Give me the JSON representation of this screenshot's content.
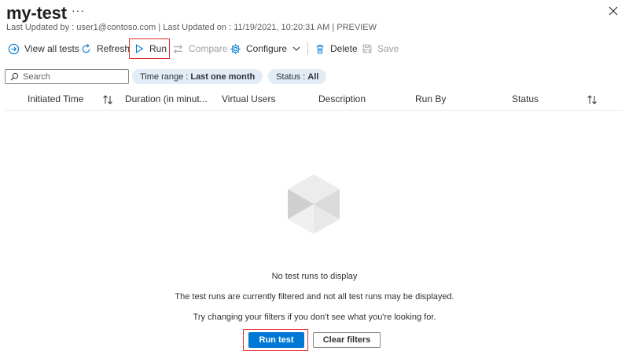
{
  "header": {
    "title": "my-test",
    "more_label": "···",
    "subtitle": "Last Updated by : user1@contoso.com | Last Updated on : 11/19/2021, 10:20:31 AM | PREVIEW"
  },
  "toolbar": {
    "view_all_tests": "View all tests",
    "refresh": "Refresh",
    "run": "Run",
    "compare": "Compare",
    "configure": "Configure",
    "delete": "Delete",
    "save": "Save"
  },
  "filters": {
    "search_placeholder": "Search",
    "time_range_label": "Time range :",
    "time_range_value": "Last one month",
    "status_label": "Status :",
    "status_value": "All"
  },
  "table": {
    "columns": [
      "Initiated Time",
      "Duration (in minut...",
      "Virtual Users",
      "Description",
      "Run By",
      "Status"
    ],
    "rows": []
  },
  "empty_state": {
    "title": "No test runs to display",
    "line1": "The test runs are currently filtered and not all test runs may be displayed.",
    "line2": "Try changing your filters if you don't see what you're looking for.",
    "primary_button": "Run test",
    "secondary_button": "Clear filters"
  },
  "colors": {
    "accent": "#0078d4",
    "highlight_border": "#e03131",
    "pill_background": "#e1ecf7",
    "disabled_text": "#a19f9d"
  },
  "icons": {
    "view_all_tests": "arrow-circle-icon",
    "refresh": "refresh-icon",
    "run": "play-icon",
    "compare": "compare-arrows-icon",
    "configure": "gear-icon",
    "delete": "trash-icon",
    "save": "save-icon",
    "empty": "cube-icon"
  }
}
